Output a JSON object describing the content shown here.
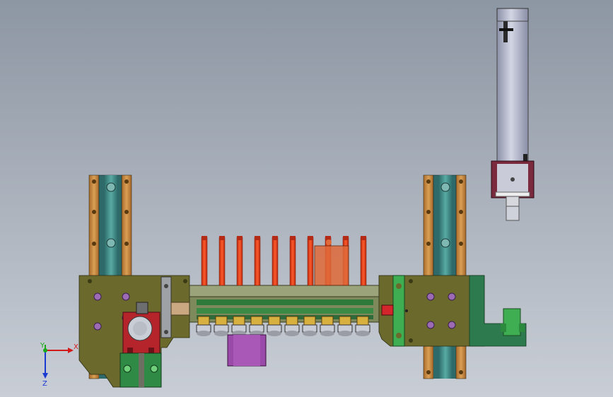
{
  "axes": {
    "x_label": "X",
    "y_label": "Y",
    "z_label": "Z"
  },
  "colors": {
    "bg_top": "#8d96a3",
    "bg_bottom": "#c7ccd4",
    "olive_plate": "#6c6a2a",
    "orange_post": "#c98a3e",
    "teal_rail": "#3d8f8a",
    "green_block": "#3f8a4a",
    "red_block": "#b2242c",
    "purple_block": "#8a4a9a",
    "grey_cylinder": "#aeb2c4",
    "maroon_mount": "#7a2a3a",
    "pin_red": "#e23a1a",
    "dark_green": "#2d7a3a"
  },
  "icons": {
    "triad": "coordinate-triad-icon"
  }
}
